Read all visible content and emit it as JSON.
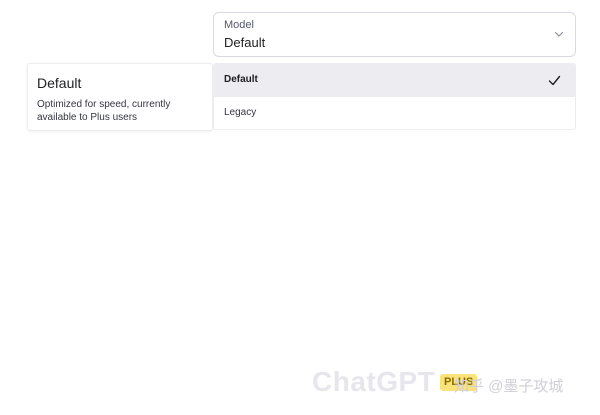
{
  "model_select": {
    "label": "Model",
    "value": "Default"
  },
  "description": {
    "title": "Default",
    "text": "Optimized for speed, currently available to Plus users"
  },
  "options": [
    {
      "label": "Default",
      "selected": true
    },
    {
      "label": "Legacy",
      "selected": false
    }
  ],
  "watermark": {
    "product": "ChatGPT",
    "badge": "PLUS",
    "credit": "知乎 @墨子攻城"
  },
  "colors": {
    "selected_bg": "#ececf1",
    "border": "#d9d9e3",
    "badge": "#f9e37a"
  },
  "icons": {
    "select_chevron": "chevron-down-icon",
    "selected_check": "check-icon"
  }
}
